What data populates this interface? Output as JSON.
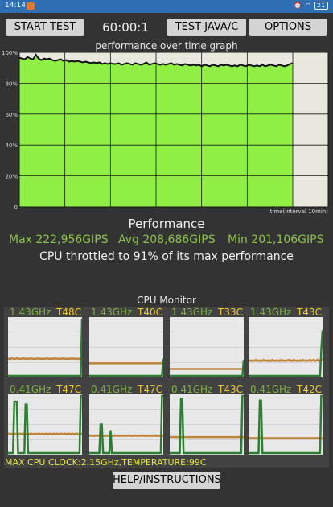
{
  "status_bar": {
    "time": "14:14",
    "battery": "21"
  },
  "toolbar": {
    "start_label": "START TEST",
    "timer": "60:00:1",
    "java_label": "TEST JAVA/C",
    "options_label": "OPTIONS"
  },
  "graph": {
    "title": "performance over time graph",
    "y_ticks": [
      "100%",
      "80%",
      "60%",
      "40%",
      "20%",
      "0"
    ],
    "x_caption": "time(interval 10min)",
    "colors": {
      "fill": "#90ef45",
      "line": "#111111",
      "empty": "#e8e8dc",
      "grid": "#1a1a1a"
    },
    "series_percent": [
      96.5,
      96.0,
      95.5,
      97.0,
      96.0,
      95.5,
      98.5,
      96.0,
      95.0,
      96.0,
      95.5,
      96.0,
      95.0,
      94.5,
      95.0,
      95.5,
      94.5,
      95.0,
      94.0,
      94.5,
      94.0,
      94.5,
      94.0,
      93.5,
      94.0,
      93.5,
      93.0,
      93.5,
      93.0,
      93.5,
      92.5,
      93.0,
      92.5,
      93.0,
      92.5,
      92.5,
      93.0,
      92.0,
      92.5,
      93.0,
      92.5,
      92.0,
      93.0,
      92.5,
      92.0,
      92.5,
      93.5,
      92.0,
      92.5,
      93.0,
      92.5,
      92.0,
      92.5,
      92.0,
      92.5,
      93.0,
      92.0,
      92.5,
      92.0,
      91.5,
      92.5,
      92.0,
      91.5,
      92.0,
      91.5,
      92.0,
      91.0,
      92.0,
      91.5,
      91.0,
      92.0,
      91.5,
      91.0,
      92.0,
      91.5,
      92.0,
      91.5,
      91.0,
      91.5,
      91.0,
      92.0,
      91.5,
      91.0,
      92.0,
      91.5,
      91.0,
      91.5,
      91.0,
      92.0,
      91.0,
      91.5,
      92.0,
      91.5,
      91.0,
      92.0,
      91.5,
      91.0,
      91.5,
      92.5,
      93.0
    ]
  },
  "performance": {
    "heading": "Performance",
    "max": "Max 222,956GIPS",
    "avg": "Avg 208,686GIPS",
    "min": "Min 201,106GIPS",
    "throttle": "CPU throttled to 91% of its max performance"
  },
  "cpu_monitor": {
    "title": "CPU Monitor",
    "colors": {
      "freq": "#2e7d32",
      "temp": "#c0843a",
      "cell_bg": "#e8e8e8"
    },
    "cores": [
      {
        "freq_label": "1.43GHz",
        "temp_label": "T48C",
        "freq_series": [
          0,
          0,
          0,
          0,
          0,
          0,
          0,
          0,
          0,
          0,
          0,
          0,
          0,
          0,
          0,
          0,
          0,
          0,
          0,
          0,
          0,
          0,
          0,
          0,
          0,
          0,
          0,
          0,
          0,
          0,
          0,
          0,
          0,
          0,
          0,
          0,
          0,
          0,
          0,
          0,
          0,
          0,
          0,
          0,
          0,
          0,
          0,
          0,
          0,
          0,
          0,
          0,
          0,
          0,
          0,
          0,
          0,
          0,
          0,
          100
        ],
        "temp_series": [
          30,
          30,
          30,
          31,
          30,
          30,
          30,
          31,
          30,
          30,
          30,
          30,
          31,
          30,
          30,
          30,
          30,
          30,
          31,
          30,
          30,
          30,
          30,
          30,
          31,
          30,
          30,
          30,
          30,
          30,
          30,
          31,
          30,
          30,
          30,
          30,
          30,
          31,
          30,
          30,
          30,
          30,
          30,
          30,
          31,
          30,
          30,
          30,
          30,
          30,
          30,
          31,
          30,
          30,
          30,
          30,
          30,
          30,
          30,
          35
        ]
      },
      {
        "freq_label": "1.43GHz",
        "temp_label": "T40C",
        "freq_series": [
          0,
          0,
          0,
          0,
          0,
          0,
          0,
          0,
          0,
          0,
          0,
          0,
          0,
          0,
          0,
          0,
          0,
          0,
          0,
          0,
          0,
          0,
          0,
          0,
          0,
          0,
          0,
          0,
          0,
          0,
          0,
          0,
          0,
          0,
          0,
          0,
          0,
          0,
          0,
          0,
          0,
          0,
          0,
          0,
          0,
          0,
          0,
          0,
          0,
          0,
          0,
          0,
          0,
          0,
          0,
          0,
          0,
          0,
          0,
          30
        ],
        "temp_series": [
          22,
          22,
          22,
          22,
          22,
          22,
          22,
          22,
          22,
          22,
          22,
          22,
          22,
          22,
          22,
          22,
          22,
          22,
          22,
          22,
          22,
          22,
          22,
          22,
          22,
          22,
          22,
          22,
          22,
          22,
          22,
          22,
          22,
          22,
          22,
          22,
          22,
          22,
          22,
          22,
          22,
          22,
          22,
          22,
          22,
          22,
          22,
          22,
          22,
          22,
          22,
          22,
          22,
          22,
          22,
          22,
          22,
          22,
          22,
          22
        ]
      },
      {
        "freq_label": "1.43GHz",
        "temp_label": "T33C",
        "freq_series": [
          0,
          0,
          0,
          0,
          0,
          0,
          0,
          0,
          0,
          0,
          0,
          0,
          0,
          0,
          0,
          0,
          0,
          0,
          0,
          0,
          0,
          0,
          0,
          0,
          0,
          0,
          0,
          0,
          0,
          0,
          0,
          0,
          0,
          0,
          0,
          0,
          0,
          0,
          0,
          0,
          0,
          0,
          0,
          0,
          0,
          0,
          0,
          0,
          0,
          0,
          0,
          0,
          0,
          0,
          0,
          0,
          0,
          0,
          0,
          28
        ],
        "temp_series": [
          12,
          12,
          12,
          12,
          12,
          12,
          12,
          12,
          12,
          12,
          12,
          12,
          12,
          12,
          12,
          12,
          12,
          12,
          12,
          12,
          12,
          12,
          12,
          12,
          12,
          12,
          12,
          12,
          12,
          12,
          12,
          12,
          12,
          12,
          12,
          12,
          12,
          12,
          12,
          12,
          12,
          12,
          12,
          12,
          12,
          12,
          12,
          12,
          12,
          12,
          12,
          12,
          12,
          12,
          12,
          12,
          12,
          12,
          12,
          12
        ]
      },
      {
        "freq_label": "1.43GHz",
        "temp_label": "T43C",
        "freq_series": [
          0,
          0,
          0,
          0,
          0,
          0,
          0,
          0,
          0,
          0,
          0,
          0,
          0,
          0,
          0,
          0,
          0,
          0,
          0,
          0,
          0,
          0,
          0,
          0,
          0,
          0,
          0,
          0,
          0,
          0,
          0,
          0,
          0,
          0,
          0,
          0,
          0,
          0,
          0,
          0,
          0,
          0,
          0,
          0,
          0,
          0,
          0,
          0,
          0,
          0,
          0,
          0,
          0,
          0,
          0,
          0,
          0,
          0,
          45,
          80
        ],
        "temp_series": [
          26,
          27,
          26,
          27,
          26,
          27,
          28,
          26,
          27,
          26,
          27,
          26,
          28,
          27,
          26,
          27,
          26,
          27,
          26,
          28,
          27,
          26,
          27,
          26,
          27,
          26,
          28,
          27,
          26,
          27,
          26,
          27,
          28,
          26,
          27,
          26,
          28,
          27,
          26,
          27,
          26,
          27,
          26,
          28,
          27,
          26,
          27,
          26,
          27,
          28,
          26,
          27,
          28,
          26,
          27,
          28,
          26,
          27,
          28,
          30
        ]
      },
      {
        "freq_label": "0.41GHz",
        "temp_label": "T47C",
        "freq_series": [
          0,
          0,
          0,
          0,
          0,
          90,
          90,
          90,
          0,
          0,
          0,
          0,
          0,
          0,
          85,
          85,
          0,
          0,
          0,
          0,
          0,
          0,
          0,
          0,
          0,
          0,
          0,
          0,
          0,
          0,
          0,
          0,
          0,
          0,
          0,
          0,
          0,
          0,
          0,
          0,
          0,
          0,
          0,
          0,
          0,
          0,
          0,
          0,
          0,
          0,
          0,
          0,
          0,
          0,
          0,
          0,
          0,
          0,
          100,
          100
        ],
        "temp_series": [
          34,
          34,
          33,
          34,
          34,
          33,
          34,
          34,
          33,
          34,
          34,
          33,
          34,
          34,
          33,
          34,
          34,
          33,
          34,
          34,
          33,
          34,
          34,
          33,
          34,
          34,
          33,
          34,
          34,
          33,
          34,
          34,
          33,
          34,
          34,
          33,
          34,
          34,
          33,
          34,
          34,
          33,
          34,
          34,
          33,
          34,
          34,
          33,
          34,
          34,
          33,
          34,
          34,
          33,
          34,
          34,
          33,
          34,
          34,
          33
        ]
      },
      {
        "freq_label": "0.41GHz",
        "temp_label": "T47C",
        "freq_series": [
          0,
          0,
          0,
          0,
          0,
          0,
          0,
          0,
          0,
          50,
          50,
          0,
          0,
          0,
          0,
          0,
          0,
          40,
          0,
          0,
          0,
          0,
          0,
          0,
          0,
          0,
          0,
          0,
          0,
          0,
          0,
          0,
          0,
          0,
          0,
          0,
          0,
          0,
          0,
          0,
          0,
          0,
          0,
          0,
          0,
          0,
          0,
          0,
          0,
          0,
          0,
          0,
          0,
          0,
          0,
          0,
          0,
          0,
          100,
          100
        ],
        "temp_series": [
          30,
          31,
          30,
          31,
          30,
          31,
          30,
          31,
          30,
          31,
          30,
          31,
          30,
          31,
          30,
          31,
          30,
          31,
          30,
          31,
          30,
          31,
          30,
          31,
          30,
          31,
          30,
          31,
          30,
          31,
          30,
          31,
          30,
          31,
          30,
          31,
          30,
          31,
          30,
          31,
          30,
          31,
          30,
          31,
          30,
          31,
          30,
          31,
          30,
          31,
          30,
          31,
          30,
          31,
          30,
          31,
          30,
          31,
          30,
          31
        ]
      },
      {
        "freq_label": "0.41GHz",
        "temp_label": "T43C",
        "freq_series": [
          0,
          0,
          0,
          0,
          0,
          0,
          0,
          0,
          0,
          95,
          95,
          0,
          0,
          0,
          0,
          0,
          0,
          0,
          0,
          0,
          0,
          0,
          0,
          0,
          0,
          0,
          0,
          0,
          0,
          0,
          0,
          0,
          0,
          0,
          0,
          0,
          0,
          0,
          0,
          0,
          0,
          0,
          0,
          0,
          0,
          0,
          0,
          0,
          0,
          0,
          0,
          0,
          0,
          0,
          0,
          0,
          0,
          0,
          100,
          100
        ],
        "temp_series": [
          28,
          28,
          28,
          28,
          28,
          28,
          28,
          28,
          28,
          28,
          28,
          28,
          28,
          28,
          28,
          28,
          28,
          28,
          28,
          28,
          28,
          28,
          28,
          28,
          28,
          28,
          28,
          28,
          28,
          28,
          28,
          28,
          28,
          28,
          28,
          28,
          28,
          28,
          28,
          28,
          28,
          28,
          28,
          28,
          28,
          28,
          28,
          28,
          28,
          28,
          28,
          28,
          28,
          28,
          28,
          28,
          28,
          28,
          28,
          28
        ]
      },
      {
        "freq_label": "0.41GHz",
        "temp_label": "T42C",
        "freq_series": [
          0,
          0,
          0,
          0,
          0,
          0,
          0,
          0,
          0,
          92,
          92,
          0,
          0,
          0,
          0,
          0,
          0,
          0,
          0,
          0,
          0,
          0,
          0,
          0,
          0,
          0,
          0,
          0,
          0,
          0,
          0,
          0,
          0,
          0,
          0,
          0,
          0,
          0,
          0,
          0,
          0,
          0,
          0,
          0,
          0,
          0,
          0,
          0,
          0,
          0,
          0,
          0,
          0,
          0,
          0,
          0,
          0,
          0,
          100,
          100
        ],
        "temp_series": [
          26,
          26,
          26,
          26,
          26,
          26,
          26,
          26,
          26,
          26,
          26,
          26,
          26,
          26,
          26,
          26,
          26,
          26,
          26,
          26,
          26,
          26,
          26,
          26,
          26,
          26,
          26,
          26,
          26,
          26,
          26,
          26,
          26,
          26,
          26,
          26,
          26,
          26,
          26,
          26,
          26,
          26,
          26,
          26,
          26,
          26,
          26,
          26,
          26,
          26,
          26,
          26,
          26,
          26,
          26,
          26,
          26,
          26,
          26,
          26
        ]
      }
    ],
    "max_clock": "MAX CPU CLOCK:2.15GHz,TEMPERATURE:99C"
  },
  "help_label": "HELP/INSTRUCTIONS"
}
